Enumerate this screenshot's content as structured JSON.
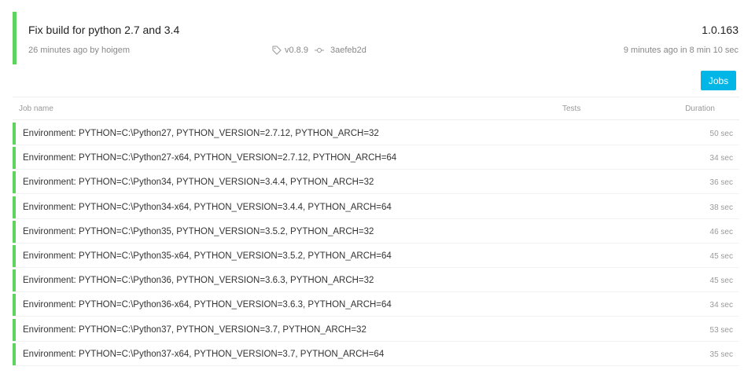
{
  "build": {
    "message": "Fix build for python 2.7 and 3.4",
    "version": "1.0.163",
    "committed": "26 minutes ago by hoigem",
    "tag": "v0.8.9",
    "commit": "3aefeb2d",
    "finished": "9 minutes ago in 8 min 10 sec"
  },
  "toolbar": {
    "jobs_label": "Jobs"
  },
  "table": {
    "headers": {
      "job": "Job name",
      "tests": "Tests",
      "duration": "Duration"
    },
    "rows": [
      {
        "name": "Environment: PYTHON=C:\\Python27, PYTHON_VERSION=2.7.12, PYTHON_ARCH=32",
        "duration": "50 sec"
      },
      {
        "name": "Environment: PYTHON=C:\\Python27-x64, PYTHON_VERSION=2.7.12, PYTHON_ARCH=64",
        "duration": "34 sec"
      },
      {
        "name": "Environment: PYTHON=C:\\Python34, PYTHON_VERSION=3.4.4, PYTHON_ARCH=32",
        "duration": "36 sec"
      },
      {
        "name": "Environment: PYTHON=C:\\Python34-x64, PYTHON_VERSION=3.4.4, PYTHON_ARCH=64",
        "duration": "38 sec"
      },
      {
        "name": "Environment: PYTHON=C:\\Python35, PYTHON_VERSION=3.5.2, PYTHON_ARCH=32",
        "duration": "46 sec"
      },
      {
        "name": "Environment: PYTHON=C:\\Python35-x64, PYTHON_VERSION=3.5.2, PYTHON_ARCH=64",
        "duration": "45 sec"
      },
      {
        "name": "Environment: PYTHON=C:\\Python36, PYTHON_VERSION=3.6.3, PYTHON_ARCH=32",
        "duration": "45 sec"
      },
      {
        "name": "Environment: PYTHON=C:\\Python36-x64, PYTHON_VERSION=3.6.3, PYTHON_ARCH=64",
        "duration": "34 sec"
      },
      {
        "name": "Environment: PYTHON=C:\\Python37, PYTHON_VERSION=3.7, PYTHON_ARCH=32",
        "duration": "53 sec"
      },
      {
        "name": "Environment: PYTHON=C:\\Python37-x64, PYTHON_VERSION=3.7, PYTHON_ARCH=64",
        "duration": "35 sec"
      }
    ]
  },
  "colors": {
    "success": "#5ed35e",
    "accent": "#00b6e6"
  },
  "icons": {
    "tag": "tag-icon",
    "commit": "commit-icon"
  }
}
